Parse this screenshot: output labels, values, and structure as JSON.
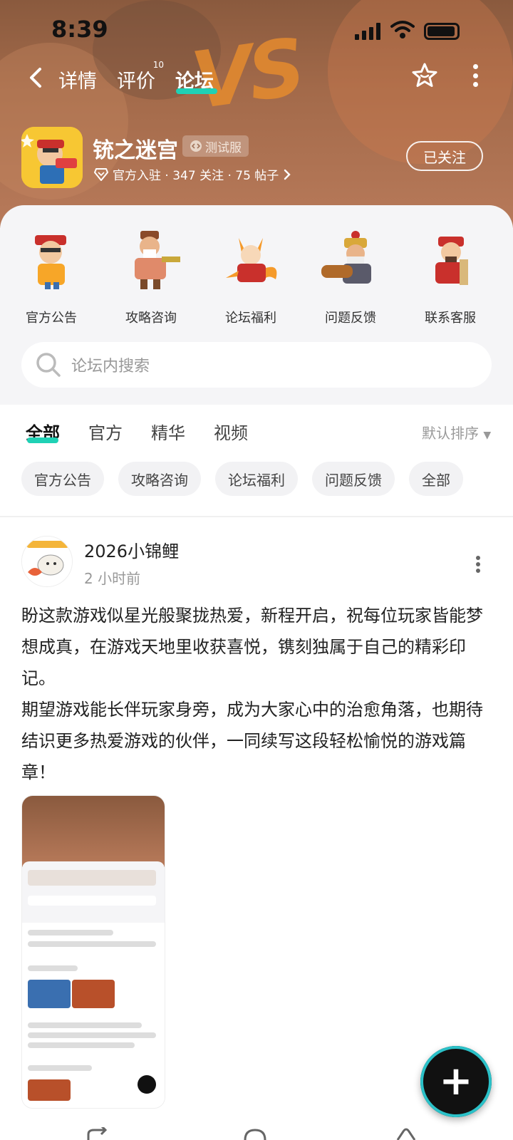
{
  "status_bar": {
    "time": "8:39"
  },
  "nav": {
    "tabs": [
      {
        "label": "详情"
      },
      {
        "label": "评价",
        "badge": "10"
      },
      {
        "label": "论坛",
        "active": true
      }
    ],
    "accent": "#1fd1b5"
  },
  "app": {
    "name": "铳之迷宫",
    "badge": "测试服",
    "meta": "官方入驻 · 347 关注 · 75 帖子",
    "follow_label": "已关注"
  },
  "categories": [
    {
      "label": "官方公告"
    },
    {
      "label": "攻略咨询"
    },
    {
      "label": "论坛福利"
    },
    {
      "label": "问题反馈"
    },
    {
      "label": "联系客服"
    }
  ],
  "search": {
    "placeholder": "论坛内搜索"
  },
  "filter_tabs": [
    {
      "label": "全部",
      "active": true
    },
    {
      "label": "官方"
    },
    {
      "label": "精华"
    },
    {
      "label": "视频"
    }
  ],
  "sort_label": "默认排序",
  "chips": [
    "官方公告",
    "攻略咨询",
    "论坛福利",
    "问题反馈",
    "全部"
  ],
  "post": {
    "author": "2026小锦鲤",
    "time": "2 小时前",
    "body_p1": "盼这款游戏似星光般聚拢热爱，新程开启，祝每位玩家皆能梦想成真，在游戏天地里收获喜悦，镌刻独属于自己的精彩印记。",
    "body_p2": "期望游戏能长伴玩家身旁，成为大家心中的治愈角落，也期待结识更多热爱游戏的伙伴，一同续写这段轻松愉悦的游戏篇章！"
  },
  "fab_label": "+"
}
